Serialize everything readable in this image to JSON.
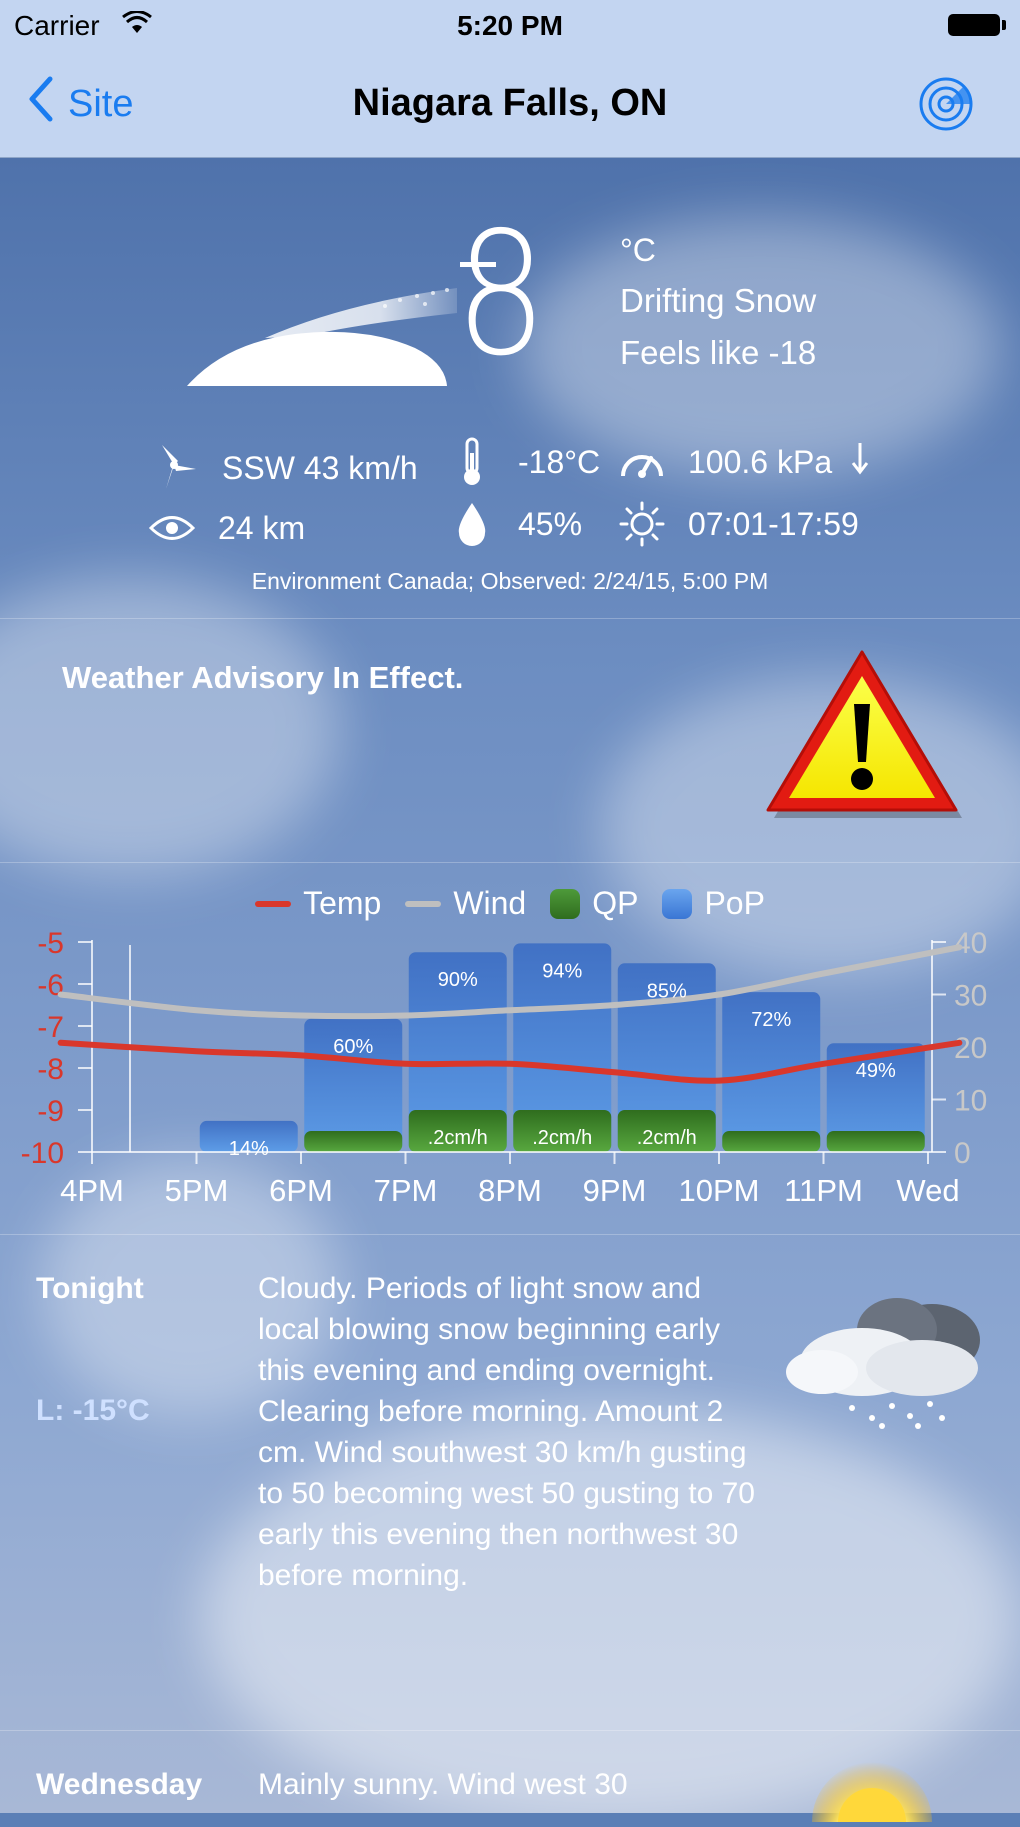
{
  "status_bar": {
    "carrier": "Carrier",
    "time": "5:20 PM"
  },
  "nav": {
    "back_label": "Site",
    "title": "Niagara Falls, ON"
  },
  "current": {
    "temperature": "8",
    "unit": "°C",
    "condition": "Drifting Snow",
    "feels_like": "Feels like -18",
    "wind": "SSW 43 km/h",
    "dewpoint": "-18°C",
    "pressure": "100.6 kPa",
    "visibility": "24 km",
    "humidity": "45%",
    "sun_times": "07:01-17:59",
    "observed": "Environment Canada; Observed: 2/24/15, 5:00 PM"
  },
  "advisory": {
    "text": "Weather Advisory In Effect."
  },
  "chart_data": {
    "type": "bar",
    "title": "",
    "legend": [
      "Temp",
      "Wind",
      "QP",
      "PoP"
    ],
    "categories": [
      "4PM",
      "5PM",
      "6PM",
      "7PM",
      "8PM",
      "9PM",
      "10PM",
      "11PM",
      "Wed"
    ],
    "left_axis": {
      "ticks": [
        "-5",
        "-6",
        "-7",
        "-8",
        "-9",
        "-10"
      ],
      "ylim": [
        -10,
        -5
      ],
      "color": "#d9372b"
    },
    "right_axis": {
      "ticks": [
        "40",
        "30",
        "20",
        "10",
        "0"
      ],
      "ylim": [
        0,
        40
      ],
      "color": "#c8c8c8"
    },
    "pop": {
      "name": "PoP",
      "values": [
        null,
        14,
        60,
        90,
        94,
        85,
        72,
        49
      ],
      "labels": [
        "",
        "14%",
        "60%",
        "90%",
        "94%",
        "85%",
        "72%",
        "49%"
      ]
    },
    "qp": {
      "name": "QP",
      "values": [
        null,
        0,
        0.1,
        0.2,
        0.2,
        0.2,
        0.1,
        0.1
      ],
      "labels": [
        "",
        "",
        "",
        ".2cm/h",
        ".2cm/h",
        ".2cm/h",
        "",
        ""
      ]
    },
    "series": [
      {
        "name": "Temp",
        "color": "#d9372b",
        "x": [
          -0.3,
          1,
          2,
          3,
          4,
          5,
          6,
          7,
          8.3
        ],
        "values": [
          -7.4,
          -7.6,
          -7.7,
          -7.9,
          -7.9,
          -8.1,
          -8.3,
          -7.9,
          -7.4
        ]
      },
      {
        "name": "Wind",
        "color": "#bfbfbf",
        "x": [
          -0.3,
          1,
          2,
          3,
          4,
          5,
          6,
          7,
          8.3
        ],
        "values": [
          30,
          27,
          26,
          26,
          27,
          28,
          30,
          34,
          39
        ]
      }
    ]
  },
  "forecast": [
    {
      "day": "Tonight",
      "low": "L: -15°C",
      "text": "Cloudy. Periods of light snow and local blowing snow beginning early this evening and ending overnight. Clearing before morning. Amount 2 cm. Wind southwest 30 km/h gusting to 50 becoming west 50 gusting to 70 early this evening then northwest 30 before morning."
    },
    {
      "day": "Wednesday",
      "text": "Mainly sunny. Wind west 30"
    }
  ]
}
